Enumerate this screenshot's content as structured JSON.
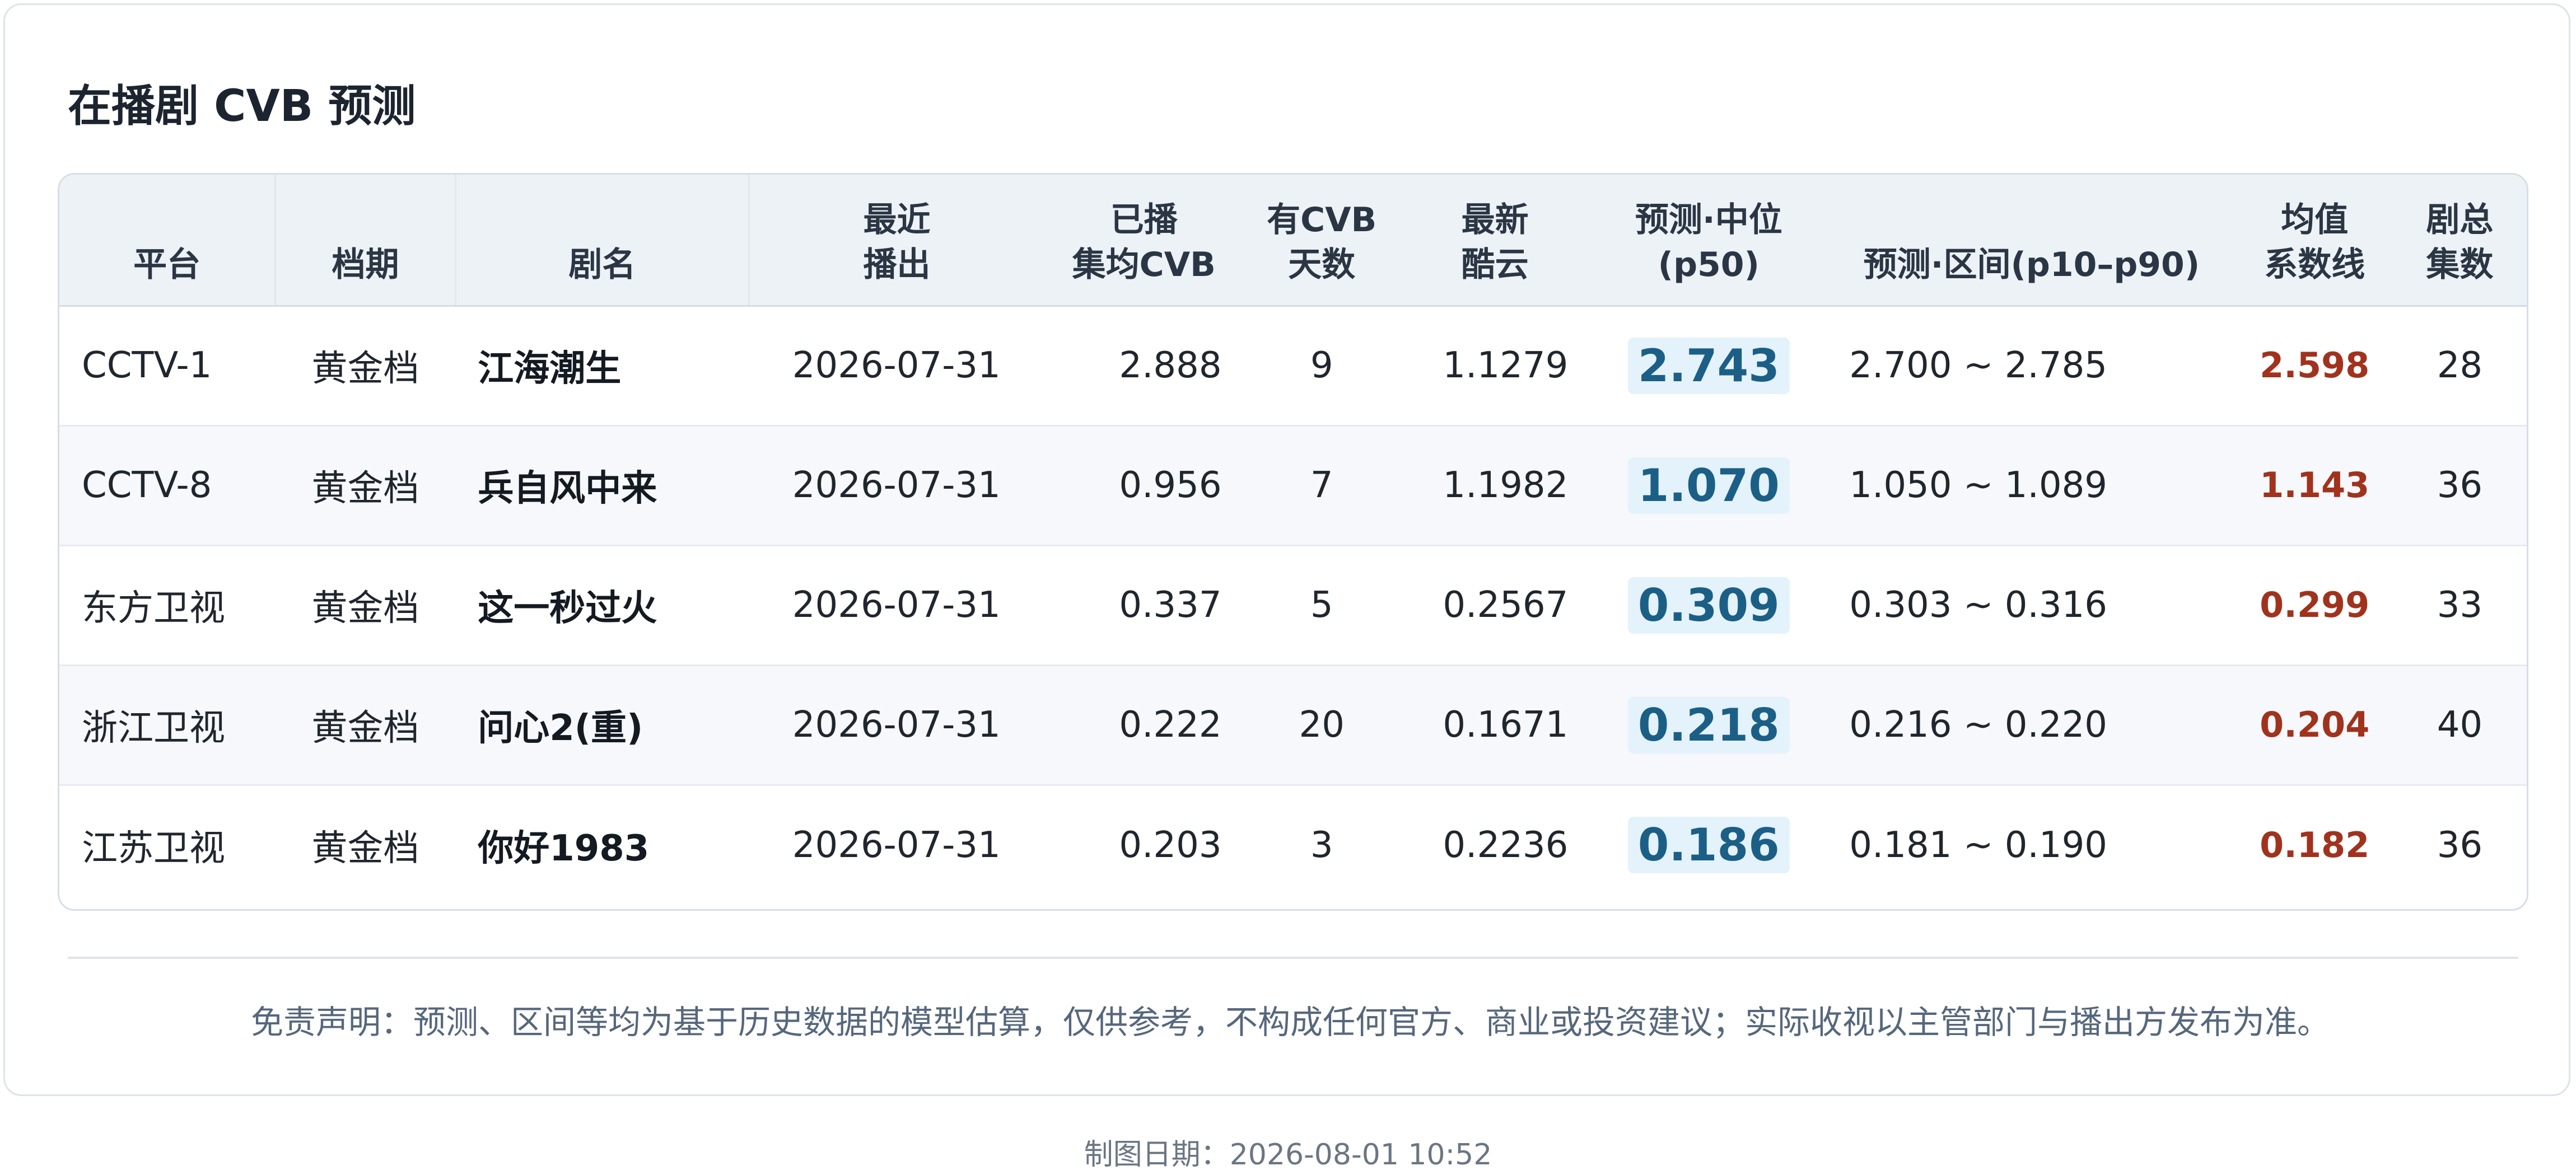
{
  "title": "在播剧 CVB 预测",
  "table": {
    "headers": [
      "平台",
      "档期",
      "剧名",
      "最近\n播出",
      "已播\n集均CVB",
      "有CVB\n天数",
      "最新\n酷云",
      "预测·中位\n(p50)",
      "预测·区间(p10–p90)",
      "均值\n系数线",
      "剧总\n集数"
    ],
    "rows": [
      {
        "platform": "CCTV-1",
        "slot": "黄金档",
        "name": "江海潮生",
        "last_air": "2026-07-31",
        "avg_cvb": "2.888",
        "days": "9",
        "kuyun": "1.1279",
        "p50": "2.743",
        "range": "2.700 ~ 2.785",
        "mean_line": "2.598",
        "episodes": "28"
      },
      {
        "platform": "CCTV-8",
        "slot": "黄金档",
        "name": "兵自风中来",
        "last_air": "2026-07-31",
        "avg_cvb": "0.956",
        "days": "7",
        "kuyun": "1.1982",
        "p50": "1.070",
        "range": "1.050 ~ 1.089",
        "mean_line": "1.143",
        "episodes": "36"
      },
      {
        "platform": "东方卫视",
        "slot": "黄金档",
        "name": "这一秒过火",
        "last_air": "2026-07-31",
        "avg_cvb": "0.337",
        "days": "5",
        "kuyun": "0.2567",
        "p50": "0.309",
        "range": "0.303 ~ 0.316",
        "mean_line": "0.299",
        "episodes": "33"
      },
      {
        "platform": "浙江卫视",
        "slot": "黄金档",
        "name": "问心2(重)",
        "last_air": "2026-07-31",
        "avg_cvb": "0.222",
        "days": "20",
        "kuyun": "0.1671",
        "p50": "0.218",
        "range": "0.216 ~ 0.220",
        "mean_line": "0.204",
        "episodes": "40"
      },
      {
        "platform": "江苏卫视",
        "slot": "黄金档",
        "name": "你好1983",
        "last_air": "2026-07-31",
        "avg_cvb": "0.203",
        "days": "3",
        "kuyun": "0.2236",
        "p50": "0.186",
        "range": "0.181 ~ 0.190",
        "mean_line": "0.182",
        "episodes": "36"
      }
    ]
  },
  "disclaimer": "免责声明：预测、区间等均为基于历史数据的模型估算，仅供参考，不构成任何官方、商业或投资建议；实际收视以主管部门与播出方发布为准。",
  "footer_date": "制图日期：2026-08-01 10:52",
  "colors": {
    "p50_text": "#1b5f86",
    "p50_bg": "#e4f2fb",
    "mean_line": "#a1321d",
    "header_bg": "#edf2f7"
  }
}
